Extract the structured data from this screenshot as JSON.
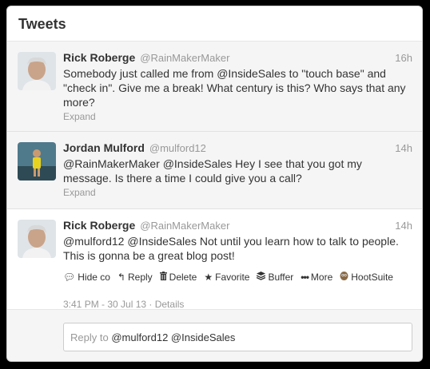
{
  "panel": {
    "title": "Tweets"
  },
  "tweets": [
    {
      "fullname": "Rick Roberge",
      "username": "@RainMakerMaker",
      "time": "16h",
      "text": "Somebody just called me from @InsideSales to \"touch base\" and \"check in\". Give me a break! What century is this? Who says that any more?",
      "expand": "Expand"
    },
    {
      "fullname": "Jordan Mulford",
      "username": "@mulford12",
      "time": "14h",
      "text": "@RainMakerMaker @InsideSales Hey I see that you got my message. Is there a time I could give you a call?",
      "expand": "Expand"
    },
    {
      "fullname": "Rick Roberge",
      "username": "@RainMakerMaker",
      "time": "14h",
      "text": "@mulford12 @InsideSales Not until you learn how to talk to people. This is gonna be a great blog post!",
      "actions": {
        "hide": "Hide co",
        "reply": "Reply",
        "delete": "Delete",
        "favorite": "Favorite",
        "buffer": "Buffer",
        "more": "More",
        "hootsuite": "HootSuite"
      },
      "meta": "3:41 PM - 30 Jul 13 · Details"
    }
  ],
  "reply": {
    "prefix": "Reply to",
    "mentions": "@mulford12 @InsideSales"
  },
  "icons": {
    "hide": "speech-bubble-icon",
    "reply": "reply-arrow-icon",
    "delete": "trash-icon",
    "favorite": "star-icon",
    "buffer": "buffer-stack-icon",
    "more": "ellipsis-icon",
    "hootsuite": "owl-icon"
  }
}
